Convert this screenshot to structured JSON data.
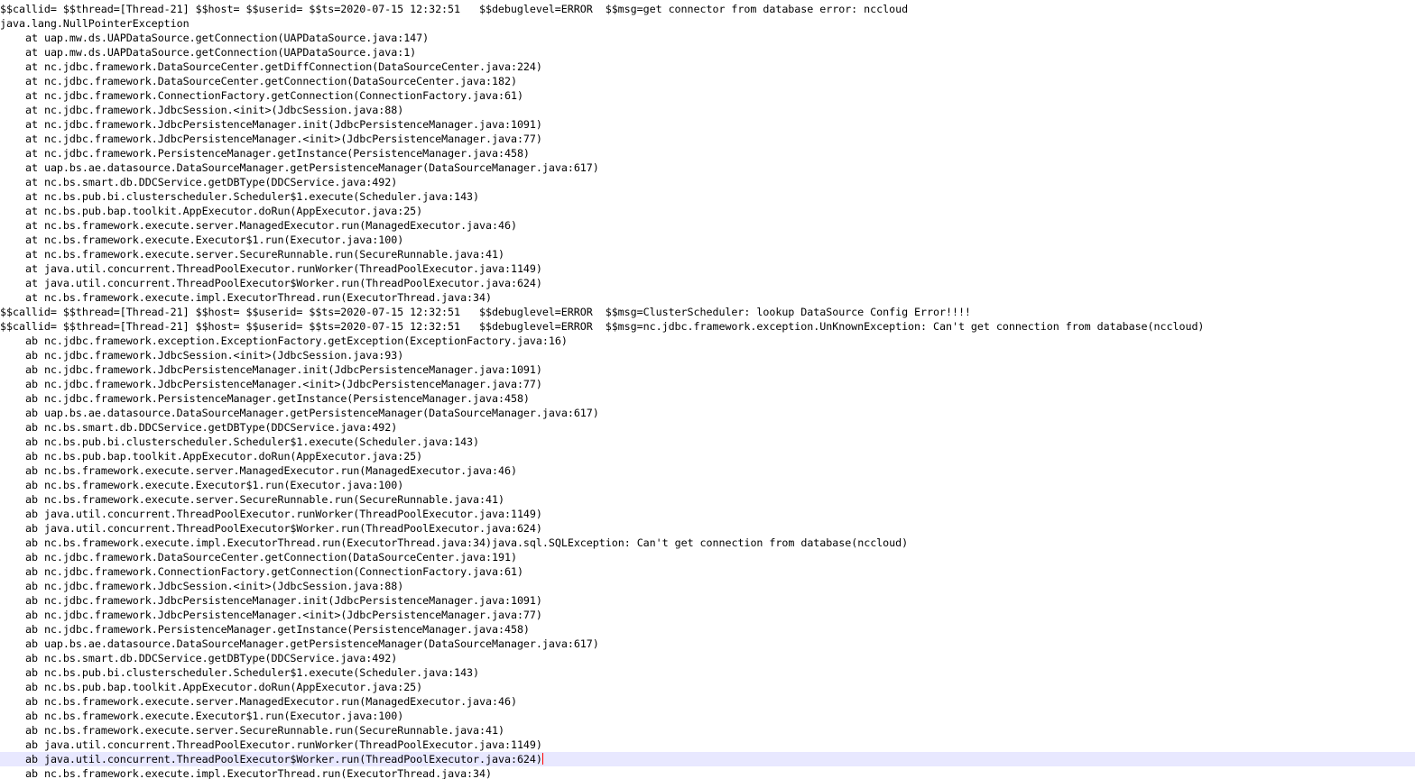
{
  "editor": {
    "current_line_index": 52,
    "lines": [
      {
        "text": "$$callid= $$thread=[Thread-21] $$host= $$userid= $$ts=2020-07-15 12:32:51   $$debuglevel=ERROR  $$msg=get connector from database error: nccloud",
        "indent": false
      },
      {
        "text": "java.lang.NullPointerException",
        "indent": false
      },
      {
        "text": "at uap.mw.ds.UAPDataSource.getConnection(UAPDataSource.java:147)",
        "indent": true
      },
      {
        "text": "at uap.mw.ds.UAPDataSource.getConnection(UAPDataSource.java:1)",
        "indent": true
      },
      {
        "text": "at nc.jdbc.framework.DataSourceCenter.getDiffConnection(DataSourceCenter.java:224)",
        "indent": true
      },
      {
        "text": "at nc.jdbc.framework.DataSourceCenter.getConnection(DataSourceCenter.java:182)",
        "indent": true
      },
      {
        "text": "at nc.jdbc.framework.ConnectionFactory.getConnection(ConnectionFactory.java:61)",
        "indent": true
      },
      {
        "text": "at nc.jdbc.framework.JdbcSession.<init>(JdbcSession.java:88)",
        "indent": true
      },
      {
        "text": "at nc.jdbc.framework.JdbcPersistenceManager.init(JdbcPersistenceManager.java:1091)",
        "indent": true
      },
      {
        "text": "at nc.jdbc.framework.JdbcPersistenceManager.<init>(JdbcPersistenceManager.java:77)",
        "indent": true
      },
      {
        "text": "at nc.jdbc.framework.PersistenceManager.getInstance(PersistenceManager.java:458)",
        "indent": true
      },
      {
        "text": "at uap.bs.ae.datasource.DataSourceManager.getPersistenceManager(DataSourceManager.java:617)",
        "indent": true
      },
      {
        "text": "at nc.bs.smart.db.DDCService.getDBType(DDCService.java:492)",
        "indent": true
      },
      {
        "text": "at nc.bs.pub.bi.clusterscheduler.Scheduler$1.execute(Scheduler.java:143)",
        "indent": true
      },
      {
        "text": "at nc.bs.pub.bap.toolkit.AppExecutor.doRun(AppExecutor.java:25)",
        "indent": true
      },
      {
        "text": "at nc.bs.framework.execute.server.ManagedExecutor.run(ManagedExecutor.java:46)",
        "indent": true
      },
      {
        "text": "at nc.bs.framework.execute.Executor$1.run(Executor.java:100)",
        "indent": true
      },
      {
        "text": "at nc.bs.framework.execute.server.SecureRunnable.run(SecureRunnable.java:41)",
        "indent": true
      },
      {
        "text": "at java.util.concurrent.ThreadPoolExecutor.runWorker(ThreadPoolExecutor.java:1149)",
        "indent": true
      },
      {
        "text": "at java.util.concurrent.ThreadPoolExecutor$Worker.run(ThreadPoolExecutor.java:624)",
        "indent": true
      },
      {
        "text": "at nc.bs.framework.execute.impl.ExecutorThread.run(ExecutorThread.java:34)",
        "indent": true
      },
      {
        "text": "$$callid= $$thread=[Thread-21] $$host= $$userid= $$ts=2020-07-15 12:32:51   $$debuglevel=ERROR  $$msg=ClusterScheduler: lookup DataSource Config Error!!!!",
        "indent": false
      },
      {
        "text": "$$callid= $$thread=[Thread-21] $$host= $$userid= $$ts=2020-07-15 12:32:51   $$debuglevel=ERROR  $$msg=nc.jdbc.framework.exception.UnKnownException: Can't get connection from database(nccloud)",
        "indent": false
      },
      {
        "text": "ab nc.jdbc.framework.exception.ExceptionFactory.getException(ExceptionFactory.java:16)",
        "indent": true
      },
      {
        "text": "ab nc.jdbc.framework.JdbcSession.<init>(JdbcSession.java:93)",
        "indent": true
      },
      {
        "text": "ab nc.jdbc.framework.JdbcPersistenceManager.init(JdbcPersistenceManager.java:1091)",
        "indent": true
      },
      {
        "text": "ab nc.jdbc.framework.JdbcPersistenceManager.<init>(JdbcPersistenceManager.java:77)",
        "indent": true
      },
      {
        "text": "ab nc.jdbc.framework.PersistenceManager.getInstance(PersistenceManager.java:458)",
        "indent": true
      },
      {
        "text": "ab uap.bs.ae.datasource.DataSourceManager.getPersistenceManager(DataSourceManager.java:617)",
        "indent": true
      },
      {
        "text": "ab nc.bs.smart.db.DDCService.getDBType(DDCService.java:492)",
        "indent": true
      },
      {
        "text": "ab nc.bs.pub.bi.clusterscheduler.Scheduler$1.execute(Scheduler.java:143)",
        "indent": true
      },
      {
        "text": "ab nc.bs.pub.bap.toolkit.AppExecutor.doRun(AppExecutor.java:25)",
        "indent": true
      },
      {
        "text": "ab nc.bs.framework.execute.server.ManagedExecutor.run(ManagedExecutor.java:46)",
        "indent": true
      },
      {
        "text": "ab nc.bs.framework.execute.Executor$1.run(Executor.java:100)",
        "indent": true
      },
      {
        "text": "ab nc.bs.framework.execute.server.SecureRunnable.run(SecureRunnable.java:41)",
        "indent": true
      },
      {
        "text": "ab java.util.concurrent.ThreadPoolExecutor.runWorker(ThreadPoolExecutor.java:1149)",
        "indent": true
      },
      {
        "text": "ab java.util.concurrent.ThreadPoolExecutor$Worker.run(ThreadPoolExecutor.java:624)",
        "indent": true
      },
      {
        "text": "ab nc.bs.framework.execute.impl.ExecutorThread.run(ExecutorThread.java:34)java.sql.SQLException: Can't get connection from database(nccloud)",
        "indent": true
      },
      {
        "text": "ab nc.jdbc.framework.DataSourceCenter.getConnection(DataSourceCenter.java:191)",
        "indent": true
      },
      {
        "text": "ab nc.jdbc.framework.ConnectionFactory.getConnection(ConnectionFactory.java:61)",
        "indent": true
      },
      {
        "text": "ab nc.jdbc.framework.JdbcSession.<init>(JdbcSession.java:88)",
        "indent": true
      },
      {
        "text": "ab nc.jdbc.framework.JdbcPersistenceManager.init(JdbcPersistenceManager.java:1091)",
        "indent": true
      },
      {
        "text": "ab nc.jdbc.framework.JdbcPersistenceManager.<init>(JdbcPersistenceManager.java:77)",
        "indent": true
      },
      {
        "text": "ab nc.jdbc.framework.PersistenceManager.getInstance(PersistenceManager.java:458)",
        "indent": true
      },
      {
        "text": "ab uap.bs.ae.datasource.DataSourceManager.getPersistenceManager(DataSourceManager.java:617)",
        "indent": true
      },
      {
        "text": "ab nc.bs.smart.db.DDCService.getDBType(DDCService.java:492)",
        "indent": true
      },
      {
        "text": "ab nc.bs.pub.bi.clusterscheduler.Scheduler$1.execute(Scheduler.java:143)",
        "indent": true
      },
      {
        "text": "ab nc.bs.pub.bap.toolkit.AppExecutor.doRun(AppExecutor.java:25)",
        "indent": true
      },
      {
        "text": "ab nc.bs.framework.execute.server.ManagedExecutor.run(ManagedExecutor.java:46)",
        "indent": true
      },
      {
        "text": "ab nc.bs.framework.execute.Executor$1.run(Executor.java:100)",
        "indent": true
      },
      {
        "text": "ab nc.bs.framework.execute.server.SecureRunnable.run(SecureRunnable.java:41)",
        "indent": true
      },
      {
        "text": "ab java.util.concurrent.ThreadPoolExecutor.runWorker(ThreadPoolExecutor.java:1149)",
        "indent": true
      },
      {
        "text": "ab java.util.concurrent.ThreadPoolExecutor$Worker.run(ThreadPoolExecutor.java:624)",
        "indent": true
      },
      {
        "text": "ab nc.bs.framework.execute.impl.ExecutorThread.run(ExecutorThread.java:34)",
        "indent": true
      }
    ]
  },
  "colors": {
    "text": "#000000",
    "background": "#ffffff",
    "current_line_highlight": "#e8e8ff",
    "caret": "#ff0000"
  }
}
